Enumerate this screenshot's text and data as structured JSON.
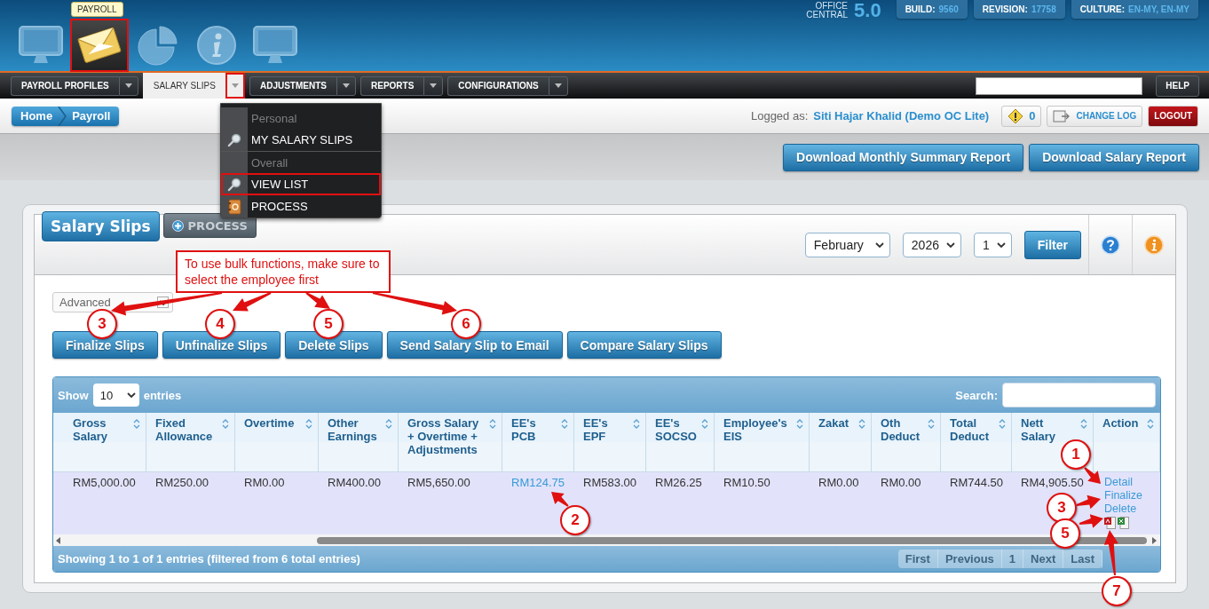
{
  "header": {
    "module_tooltip": "PAYROLL",
    "modules": [
      {
        "kind": "monitor",
        "selected": false,
        "highlighted": false
      },
      {
        "kind": "mail",
        "selected": true,
        "highlighted": true
      },
      {
        "kind": "pie",
        "selected": false,
        "highlighted": false
      },
      {
        "kind": "info",
        "selected": false,
        "highlighted": false
      },
      {
        "kind": "monitor",
        "selected": false,
        "highlighted": false
      }
    ],
    "app_name": "OFFICE CENTRAL",
    "version": "5.0",
    "info": [
      {
        "label": "BUILD:",
        "value": "9560"
      },
      {
        "label": "REVISION:",
        "value": "17758"
      },
      {
        "label": "CULTURE:",
        "value": "EN-MY, EN-MY"
      }
    ]
  },
  "nav": {
    "tabs": [
      {
        "label": "PAYROLL PROFILES",
        "selected": false,
        "highlighted": false
      },
      {
        "label": "SALARY SLIPS",
        "selected": true,
        "highlighted": true
      },
      {
        "label": "ADJUSTMENTS",
        "selected": false,
        "highlighted": false
      },
      {
        "label": "REPORTS",
        "selected": false,
        "highlighted": false
      },
      {
        "label": "CONFIGURATIONS",
        "selected": false,
        "highlighted": false
      }
    ],
    "help": "HELP"
  },
  "dropdown": {
    "sections": [
      {
        "heading": "Personal",
        "items": [
          {
            "label": "MY SALARY SLIPS",
            "kind": "search",
            "highlighted": false
          }
        ]
      },
      {
        "heading": "Overall",
        "items": [
          {
            "label": "VIEW LIST",
            "kind": "search",
            "highlighted": true
          },
          {
            "label": "PROCESS",
            "kind": "contacts",
            "highlighted": false
          }
        ]
      }
    ]
  },
  "breadcrumb": [
    "Home",
    "Payroll"
  ],
  "user": {
    "prefix": "Logged as:",
    "name": "Siti Hajar Khalid (Demo OC Lite)",
    "alerts": "0",
    "change_log": "CHANGE LOG",
    "logout": "LOGOUT"
  },
  "report_buttons": [
    "Download Monthly Summary Report",
    "Download Salary Report"
  ],
  "panel": {
    "title": "Salary Slips",
    "process": "PROCESS",
    "filters": [
      {
        "value": "February"
      },
      {
        "value": "2026"
      },
      {
        "value": "1"
      }
    ],
    "filter_button": "Filter",
    "advanced": "Advanced",
    "bulk_buttons": [
      "Finalize Slips",
      "Unfinalize Slips",
      "Delete Slips",
      "Send Salary Slip to Email",
      "Compare Salary Slips"
    ]
  },
  "table": {
    "show_label": "Show",
    "page_size": "10",
    "entries_label": "entries",
    "search_label": "Search:",
    "columns": [
      "Gross Salary",
      "Fixed Allowance",
      "Overtime",
      "Other Earnings",
      "Gross Salary + Overtime + Adjustments",
      "EE's PCB",
      "EE's EPF",
      "EE's SOCSO",
      "Employee's EIS",
      "Zakat",
      "Oth Deduct",
      "Total Deduct",
      "Nett Salary",
      "Action"
    ],
    "rows": [
      {
        "cells": [
          {
            "text": "RM5,000.00",
            "kind": "amount"
          },
          {
            "text": "RM250.00",
            "kind": "amount"
          },
          {
            "text": "RM0.00",
            "kind": "amount"
          },
          {
            "text": "RM400.00",
            "kind": "amount"
          },
          {
            "text": "RM5,650.00",
            "kind": "amount"
          },
          {
            "text": "RM124.75",
            "kind": "link"
          },
          {
            "text": "RM583.00",
            "kind": "amount"
          },
          {
            "text": "RM26.25",
            "kind": "amount"
          },
          {
            "text": "RM10.50",
            "kind": "amount"
          },
          {
            "text": "RM0.00",
            "kind": "amount"
          },
          {
            "text": "RM0.00",
            "kind": "amount"
          },
          {
            "text": "RM744.50",
            "kind": "amount"
          },
          {
            "text": "RM4,905.50",
            "kind": "amount"
          }
        ],
        "actions": [
          "Detail",
          "Finalize",
          "Delete"
        ]
      }
    ],
    "info": "Showing 1 to 1 of 1 entries (filtered from 6 total entries)",
    "pager": [
      "First",
      "Previous",
      "1",
      "Next",
      "Last"
    ]
  },
  "annotations": {
    "note": "To use bulk functions, make sure to select the employee first",
    "markers": [
      "3",
      "4",
      "5",
      "6",
      "1",
      "3",
      "2",
      "5",
      "7"
    ]
  }
}
